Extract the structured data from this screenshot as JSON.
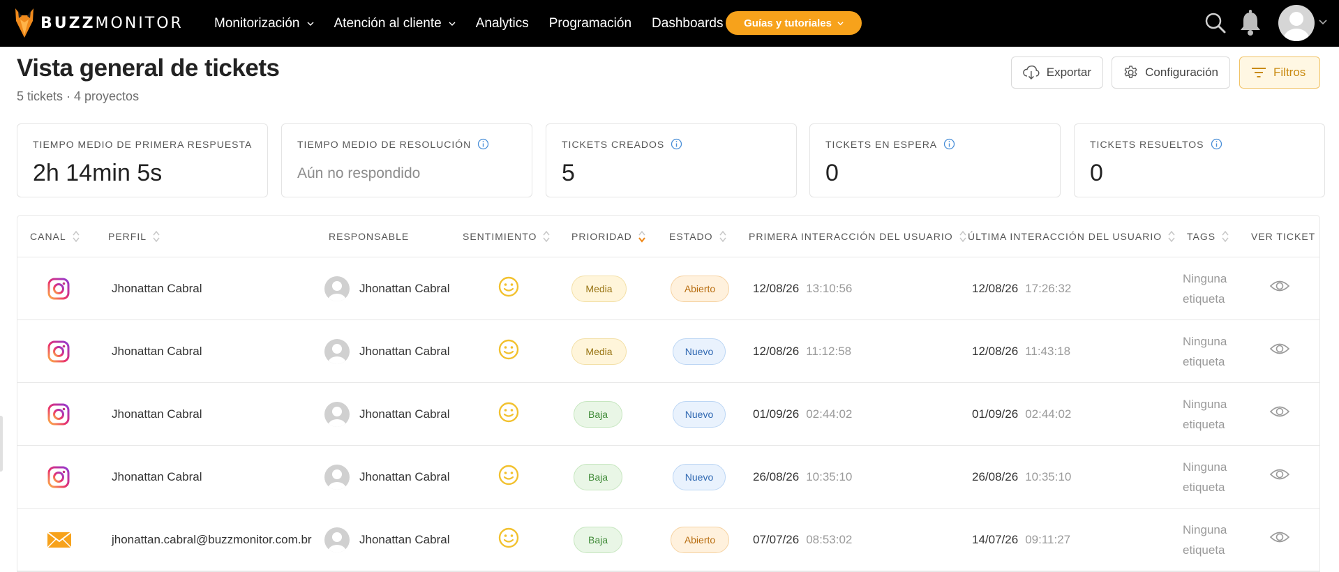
{
  "nav": {
    "brand_bold": "BUZZ",
    "brand_light": "MONITOR",
    "items": [
      {
        "label": "Monitorización",
        "has_chevron": true
      },
      {
        "label": "Atención al cliente",
        "has_chevron": true
      },
      {
        "label": "Analytics",
        "has_chevron": false
      },
      {
        "label": "Programación",
        "has_chevron": false
      },
      {
        "label": "Dashboards",
        "has_chevron": false
      }
    ],
    "guides_label": "Guías y tutoriales",
    "icons": [
      "search-icon",
      "bell-icon",
      "avatar"
    ],
    "accent_color": "#f7a21b"
  },
  "header": {
    "title": "Vista general de tickets",
    "subtitle": "5 tickets · 4 proyectos",
    "export_label": "Exportar",
    "config_label": "Configuración",
    "filters_label": "Filtros"
  },
  "stats": [
    {
      "label": "TIEMPO MEDIO DE PRIMERA RESPUESTA",
      "value": "2h 14min 5s",
      "muted": false
    },
    {
      "label": "TIEMPO MEDIO DE RESOLUCIÓN",
      "value": "Aún no respondido",
      "muted": true
    },
    {
      "label": "TICKETS CREADOS",
      "value": "5",
      "muted": false
    },
    {
      "label": "TICKETS EN ESPERA",
      "value": "0",
      "muted": false
    },
    {
      "label": "TICKETS RESUELTOS",
      "value": "0",
      "muted": false
    }
  ],
  "table": {
    "columns": [
      {
        "label": "CANAL",
        "sortable": true
      },
      {
        "label": "PERFIL",
        "sortable": true
      },
      {
        "label": "RESPONSABLE",
        "sortable": false
      },
      {
        "label": "SENTIMIENTO",
        "sortable": true
      },
      {
        "label": "PRIORIDAD",
        "sortable": true,
        "active_sort": "desc"
      },
      {
        "label": "ESTADO",
        "sortable": true
      },
      {
        "label": "PRIMERA INTERACCIÓN DEL USUARIO",
        "sortable": true
      },
      {
        "label": "ÚLTIMA INTERACCIÓN DEL USUARIO",
        "sortable": true
      },
      {
        "label": "TAGS",
        "sortable": true
      },
      {
        "label": "VER TICKET",
        "sortable": false
      }
    ],
    "rows": [
      {
        "channel": "instagram",
        "profile": "Jhonattan Cabral",
        "owner": "Jhonattan Cabral",
        "sentiment": "neutral-face",
        "priority": "Media",
        "priority_kind": "media",
        "status": "Abierto",
        "status_kind": "abierto",
        "first_date": "12/08/26",
        "first_time": "13:10:56",
        "last_date": "12/08/26",
        "last_time": "17:26:32",
        "tags": "Ninguna etiqueta"
      },
      {
        "channel": "instagram",
        "profile": "Jhonattan Cabral",
        "owner": "Jhonattan Cabral",
        "sentiment": "neutral-face",
        "priority": "Media",
        "priority_kind": "media",
        "status": "Nuevo",
        "status_kind": "nuevo",
        "first_date": "12/08/26",
        "first_time": "11:12:58",
        "last_date": "12/08/26",
        "last_time": "11:43:18",
        "tags": "Ninguna etiqueta"
      },
      {
        "channel": "instagram",
        "profile": "Jhonattan Cabral",
        "owner": "Jhonattan Cabral",
        "sentiment": "neutral-face",
        "priority": "Baja",
        "priority_kind": "baja",
        "status": "Nuevo",
        "status_kind": "nuevo",
        "first_date": "01/09/26",
        "first_time": "02:44:02",
        "last_date": "01/09/26",
        "last_time": "02:44:02",
        "tags": "Ninguna etiqueta"
      },
      {
        "channel": "instagram",
        "profile": "Jhonattan Cabral",
        "owner": "Jhonattan Cabral",
        "sentiment": "neutral-face",
        "priority": "Baja",
        "priority_kind": "baja",
        "status": "Nuevo",
        "status_kind": "nuevo",
        "first_date": "26/08/26",
        "first_time": "10:35:10",
        "last_date": "26/08/26",
        "last_time": "10:35:10",
        "tags": "Ninguna etiqueta"
      },
      {
        "channel": "email",
        "profile": "jhonattan.cabral@buzzmonitor.com.br",
        "owner": "Jhonattan Cabral",
        "sentiment": "neutral-face",
        "priority": "Baja",
        "priority_kind": "baja",
        "status": "Abierto",
        "status_kind": "abierto",
        "first_date": "07/07/26",
        "first_time": "08:53:02",
        "last_date": "14/07/26",
        "last_time": "09:11:27",
        "tags": "Ninguna etiqueta"
      }
    ]
  }
}
